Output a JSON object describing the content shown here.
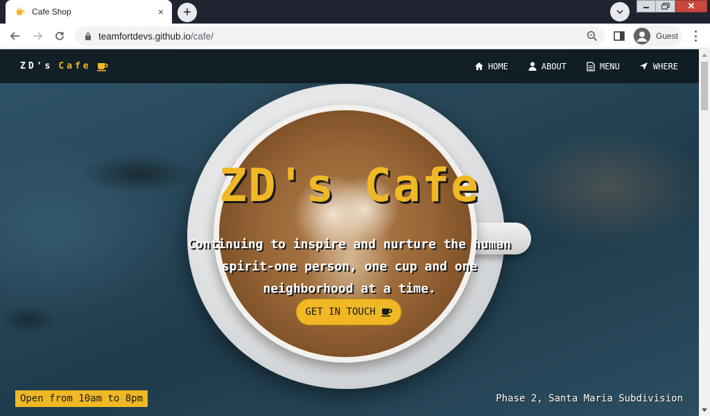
{
  "browser": {
    "tab_title": "Cafe Shop",
    "tab_close": "×",
    "new_tab": "+",
    "url_host": "teamfortdevs.github.io",
    "url_path": "/cafe/",
    "profile_label": "Guest",
    "window_close": "✕"
  },
  "nav": {
    "brand_part1": "ZD's",
    "brand_part2": "Cafe",
    "items": [
      {
        "label": "HOME",
        "icon": "home-icon"
      },
      {
        "label": "ABOUT",
        "icon": "user-icon"
      },
      {
        "label": "MENU",
        "icon": "document-icon"
      },
      {
        "label": "WHERE",
        "icon": "location-arrow-icon"
      }
    ]
  },
  "hero": {
    "title": "ZD's Cafe",
    "subtitle": "Continuing to inspire and nurture the human spirit-one person, one cup and one neighborhood at a time.",
    "cta_label": "GET IN TOUCH"
  },
  "footer": {
    "hours": "Open from 10am to 8pm",
    "address": "Phase 2, Santa Maria Subdivision"
  },
  "colors": {
    "accent": "#f0b825",
    "nav_bg": "#0f181e"
  }
}
